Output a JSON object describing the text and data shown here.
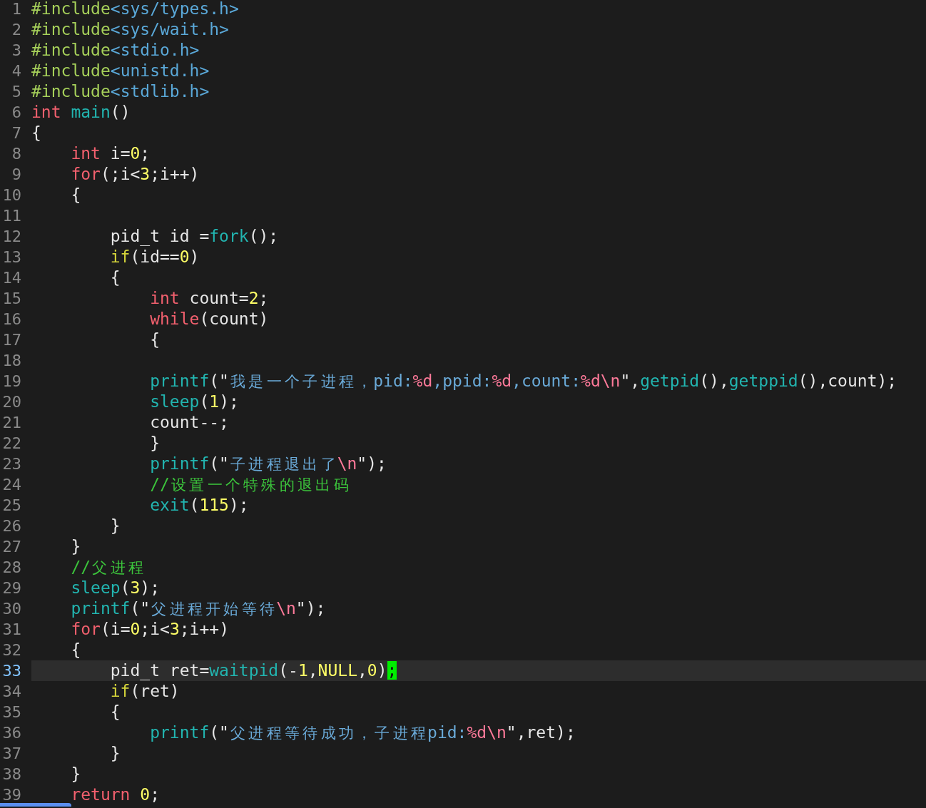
{
  "editor": {
    "lines": [
      {
        "number": "1",
        "current": false,
        "tokens": [
          {
            "text": "#include",
            "kind": "include"
          },
          {
            "text": "<sys/types.h>",
            "kind": "header"
          }
        ]
      },
      {
        "number": "2",
        "current": false,
        "tokens": [
          {
            "text": "#include",
            "kind": "include"
          },
          {
            "text": "<sys/wait.h>",
            "kind": "header"
          }
        ]
      },
      {
        "number": "3",
        "current": false,
        "tokens": [
          {
            "text": "#include",
            "kind": "include"
          },
          {
            "text": "<stdio.h>",
            "kind": "header"
          }
        ]
      },
      {
        "number": "4",
        "current": false,
        "tokens": [
          {
            "text": "#include",
            "kind": "include"
          },
          {
            "text": "<unistd.h>",
            "kind": "header"
          }
        ]
      },
      {
        "number": "5",
        "current": false,
        "tokens": [
          {
            "text": "#include",
            "kind": "include"
          },
          {
            "text": "<stdlib.h>",
            "kind": "header"
          }
        ]
      },
      {
        "number": "6",
        "current": false,
        "tokens": [
          {
            "text": "int ",
            "kind": "keyword"
          },
          {
            "text": "main",
            "kind": "func"
          },
          {
            "text": "()",
            "kind": "plain"
          }
        ]
      },
      {
        "number": "7",
        "current": false,
        "tokens": [
          {
            "text": "{",
            "kind": "plain"
          }
        ]
      },
      {
        "number": "8",
        "current": false,
        "tokens": [
          {
            "text": "    int",
            "kind": "keyword"
          },
          {
            "text": " i=",
            "kind": "plain"
          },
          {
            "text": "0",
            "kind": "number"
          },
          {
            "text": ";",
            "kind": "plain"
          }
        ]
      },
      {
        "number": "9",
        "current": false,
        "tokens": [
          {
            "text": "    for",
            "kind": "keyword"
          },
          {
            "text": "(;i<",
            "kind": "plain"
          },
          {
            "text": "3",
            "kind": "number"
          },
          {
            "text": ";i++)",
            "kind": "plain"
          }
        ]
      },
      {
        "number": "10",
        "current": false,
        "tokens": [
          {
            "text": "    {",
            "kind": "plain"
          }
        ]
      },
      {
        "number": "11",
        "current": false
      },
      {
        "number": "12",
        "current": false,
        "tokens": [
          {
            "text": "        pid_t id =",
            "kind": "plain"
          },
          {
            "text": "fork",
            "kind": "func"
          },
          {
            "text": "();",
            "kind": "plain"
          }
        ]
      },
      {
        "number": "13",
        "current": false,
        "tokens": [
          {
            "text": "        if",
            "kind": "conditional"
          },
          {
            "text": "(id==",
            "kind": "plain"
          },
          {
            "text": "0",
            "kind": "number"
          },
          {
            "text": ")",
            "kind": "plain"
          }
        ]
      },
      {
        "number": "14",
        "current": false,
        "tokens": [
          {
            "text": "        {",
            "kind": "plain"
          }
        ]
      },
      {
        "number": "15",
        "current": false,
        "tokens": [
          {
            "text": "            int",
            "kind": "keyword"
          },
          {
            "text": " count=",
            "kind": "plain"
          },
          {
            "text": "2",
            "kind": "number"
          },
          {
            "text": ";",
            "kind": "plain"
          }
        ]
      },
      {
        "number": "16",
        "current": false,
        "tokens": [
          {
            "text": "            while",
            "kind": "keyword"
          },
          {
            "text": "(count)",
            "kind": "plain"
          }
        ]
      },
      {
        "number": "17",
        "current": false,
        "tokens": [
          {
            "text": "            {",
            "kind": "plain"
          }
        ]
      },
      {
        "number": "18",
        "current": false
      },
      {
        "number": "19",
        "current": false,
        "tokens": [
          {
            "text": "            printf",
            "kind": "func"
          },
          {
            "text": "(\"",
            "kind": "plain"
          },
          {
            "text": "我是一个子进程，pid:",
            "kind": "string"
          },
          {
            "text": "%d",
            "kind": "format"
          },
          {
            "text": ",ppid:",
            "kind": "string"
          },
          {
            "text": "%d",
            "kind": "format"
          },
          {
            "text": ",count:",
            "kind": "string"
          },
          {
            "text": "%d\\n",
            "kind": "format"
          },
          {
            "text": "\",",
            "kind": "plain"
          },
          {
            "text": "getpid",
            "kind": "func"
          },
          {
            "text": "(),",
            "kind": "plain"
          },
          {
            "text": "getppid",
            "kind": "func"
          },
          {
            "text": "(),count);",
            "kind": "plain"
          }
        ]
      },
      {
        "number": "20",
        "current": false,
        "tokens": [
          {
            "text": "            sleep",
            "kind": "func"
          },
          {
            "text": "(",
            "kind": "plain"
          },
          {
            "text": "1",
            "kind": "number"
          },
          {
            "text": ");",
            "kind": "plain"
          }
        ]
      },
      {
        "number": "21",
        "current": false,
        "tokens": [
          {
            "text": "            count--;",
            "kind": "plain"
          }
        ]
      },
      {
        "number": "22",
        "current": false,
        "tokens": [
          {
            "text": "            }",
            "kind": "plain"
          }
        ]
      },
      {
        "number": "23",
        "current": false,
        "tokens": [
          {
            "text": "            printf",
            "kind": "func"
          },
          {
            "text": "(\"",
            "kind": "plain"
          },
          {
            "text": "子进程退出了",
            "kind": "string"
          },
          {
            "text": "\\n",
            "kind": "format"
          },
          {
            "text": "\");",
            "kind": "plain"
          }
        ]
      },
      {
        "number": "24",
        "current": false,
        "tokens": [
          {
            "text": "            //设置一个特殊的退出码",
            "kind": "comment"
          }
        ]
      },
      {
        "number": "25",
        "current": false,
        "tokens": [
          {
            "text": "            exit",
            "kind": "func"
          },
          {
            "text": "(",
            "kind": "plain"
          },
          {
            "text": "115",
            "kind": "number"
          },
          {
            "text": ");",
            "kind": "plain"
          }
        ]
      },
      {
        "number": "26",
        "current": false,
        "tokens": [
          {
            "text": "        }",
            "kind": "plain"
          }
        ]
      },
      {
        "number": "27",
        "current": false,
        "tokens": [
          {
            "text": "    }",
            "kind": "plain"
          }
        ]
      },
      {
        "number": "28",
        "current": false,
        "tokens": [
          {
            "text": "    //父进程",
            "kind": "comment"
          }
        ]
      },
      {
        "number": "29",
        "current": false,
        "tokens": [
          {
            "text": "    sleep",
            "kind": "func"
          },
          {
            "text": "(",
            "kind": "plain"
          },
          {
            "text": "3",
            "kind": "number"
          },
          {
            "text": ");",
            "kind": "plain"
          }
        ]
      },
      {
        "number": "30",
        "current": false,
        "tokens": [
          {
            "text": "    printf",
            "kind": "func"
          },
          {
            "text": "(\"",
            "kind": "plain"
          },
          {
            "text": "父进程开始等待",
            "kind": "string"
          },
          {
            "text": "\\n",
            "kind": "format"
          },
          {
            "text": "\");",
            "kind": "plain"
          }
        ]
      },
      {
        "number": "31",
        "current": false,
        "tokens": [
          {
            "text": "    for",
            "kind": "keyword"
          },
          {
            "text": "(i=",
            "kind": "plain"
          },
          {
            "text": "0",
            "kind": "number"
          },
          {
            "text": ";i<",
            "kind": "plain"
          },
          {
            "text": "3",
            "kind": "number"
          },
          {
            "text": ";i++)",
            "kind": "plain"
          }
        ]
      },
      {
        "number": "32",
        "current": false,
        "tokens": [
          {
            "text": "    {",
            "kind": "plain"
          }
        ]
      },
      {
        "number": "33",
        "current": true,
        "tokens": [
          {
            "text": "        pid_t ret=",
            "kind": "plain"
          },
          {
            "text": "waitpid",
            "kind": "func"
          },
          {
            "text": "(-",
            "kind": "plain"
          },
          {
            "text": "1",
            "kind": "number"
          },
          {
            "text": ",",
            "kind": "plain"
          },
          {
            "text": "NULL",
            "kind": "constant"
          },
          {
            "text": ",",
            "kind": "plain"
          },
          {
            "text": "0",
            "kind": "number"
          },
          {
            "text": ")",
            "kind": "plain"
          },
          {
            "text": ";",
            "kind": "cursor"
          }
        ]
      },
      {
        "number": "34",
        "current": false,
        "tokens": [
          {
            "text": "        if",
            "kind": "conditional"
          },
          {
            "text": "(ret)",
            "kind": "plain"
          }
        ]
      },
      {
        "number": "35",
        "current": false,
        "tokens": [
          {
            "text": "        {",
            "kind": "plain"
          }
        ]
      },
      {
        "number": "36",
        "current": false,
        "tokens": [
          {
            "text": "            printf",
            "kind": "func"
          },
          {
            "text": "(\"",
            "kind": "plain"
          },
          {
            "text": "父进程等待成功，子进程pid:",
            "kind": "string"
          },
          {
            "text": "%d\\n",
            "kind": "format"
          },
          {
            "text": "\",ret);",
            "kind": "plain"
          }
        ]
      },
      {
        "number": "37",
        "current": false,
        "tokens": [
          {
            "text": "        }",
            "kind": "plain"
          }
        ]
      },
      {
        "number": "38",
        "current": false,
        "tokens": [
          {
            "text": "    }",
            "kind": "plain"
          }
        ]
      },
      {
        "number": "39",
        "current": false,
        "tokens": [
          {
            "text": "    return ",
            "kind": "keyword"
          },
          {
            "text": "0",
            "kind": "number"
          },
          {
            "text": ";",
            "kind": "plain"
          }
        ]
      }
    ]
  }
}
